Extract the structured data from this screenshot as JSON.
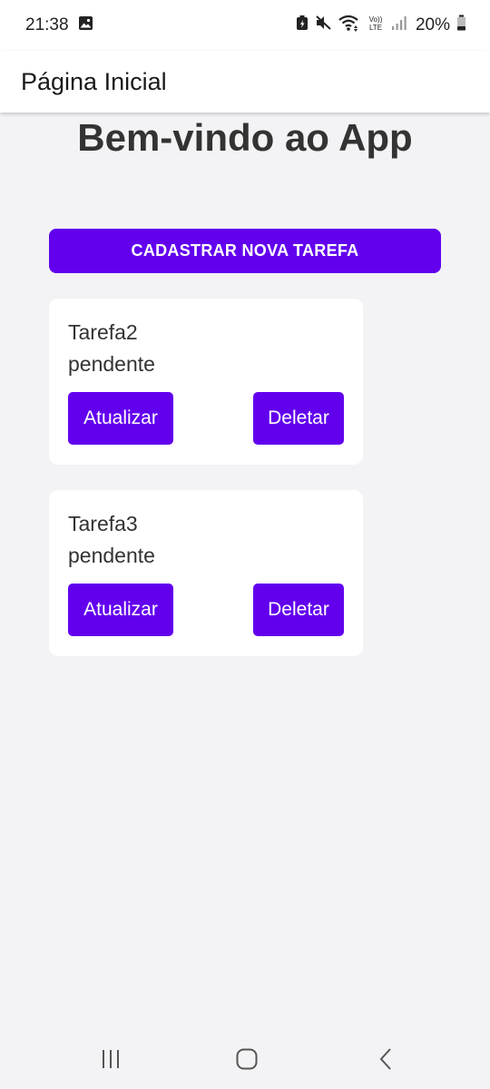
{
  "status_bar": {
    "time": "21:38",
    "battery_percent": "20%",
    "volte_label": "Vo))\nLTE",
    "icons": [
      "gallery-icon",
      "battery-saver-icon",
      "mute-icon",
      "wifi-icon",
      "volte-icon",
      "signal-icon",
      "battery-icon"
    ]
  },
  "app_bar": {
    "title": "Página Inicial"
  },
  "main": {
    "welcome": "Bem-vindo ao App",
    "new_task_button": "CADASTRAR NOVA TAREFA",
    "tasks": [
      {
        "title": "Tarefa2",
        "status": "pendente",
        "update_label": "Atualizar",
        "delete_label": "Deletar"
      },
      {
        "title": "Tarefa3",
        "status": "pendente",
        "update_label": "Atualizar",
        "delete_label": "Deletar"
      }
    ]
  },
  "nav_bar": {
    "icons": [
      "recent-apps-icon",
      "home-icon",
      "back-icon"
    ]
  },
  "colors": {
    "accent": "#6200ee",
    "background": "#f3f3f5",
    "card": "#ffffff"
  }
}
